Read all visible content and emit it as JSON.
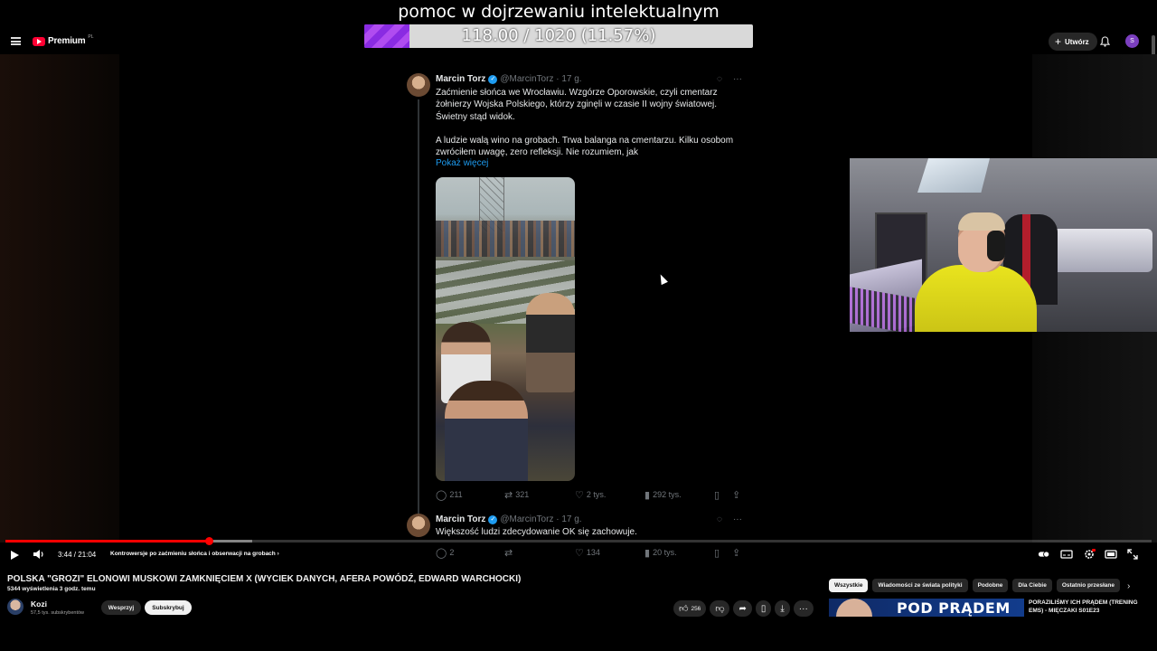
{
  "overlay": {
    "goal_title": "pomoc w dojrzewaniu intelektualnym",
    "goal_progress_text": "118.00 / 1020 (11.57%)",
    "goal_fraction": 0.1157,
    "fill_color": "#8a2be2"
  },
  "header": {
    "logo_text": "Premium",
    "logo_region": "PL",
    "create_label": "Utwórz",
    "avatar_initial": "S",
    "icons": [
      "menu-icon",
      "bell-icon"
    ]
  },
  "tweets": [
    {
      "name": "Marcin Torz",
      "handle": "@MarcinTorz · 17 g.",
      "paragraph1": "Zaćmienie słońca we Wrocławiu. Wzgórze Oporowskie, czyli cmentarz żołnierzy Wojska Polskiego, którzy zginęli w czasie II wojny światowej. Świetny stąd widok.",
      "paragraph2": "A ludzie walą wino na grobach. Trwa balanga na cmentarzu. Kilku osobom zwróciłem uwagę, zero refleksji. Nie rozumiem, jak",
      "show_more": "Pokaż więcej",
      "replies": "211",
      "retweets": "321",
      "likes": "2 tys.",
      "views": "292 tys."
    },
    {
      "name": "Marcin Torz",
      "handle": "@MarcinTorz · 17 g.",
      "text": "Większość ludzi zdecydowanie OK się zachowuje.",
      "replies": "2",
      "retweets": "",
      "likes": "134",
      "views": "20 tys."
    }
  ],
  "player": {
    "time": "3:44 / 21:04",
    "chapter": "Kontrowersje po zaćmieniu słońca i obserwacji na grobach",
    "played_fraction": 0.1776,
    "buffered_fraction": 0.215,
    "progress_color": "#ff0000"
  },
  "video": {
    "title": "POLSKA \"GROZI\" ELONOWI MUSKOWI ZAMKNIĘCIEM X (WYCIEK DANYCH, AFERA POWÓDŹ, EDWARD WARCHOCKI)",
    "meta": "5344 wyświetlenia  3 godz. temu",
    "channel_name": "Kozi",
    "channel_subs": "57,5 tys. subskrybentów",
    "support_label": "Wesprzyj",
    "subscribe_label": "Subskrybuj",
    "likes": "256"
  },
  "sidebar": {
    "chips": [
      "Wszystkie",
      "Wiadomości ze świata polityki",
      "Podobne",
      "Dla Ciebie",
      "Ostatnio przesłane"
    ],
    "rec_thumb_text": "POD PRĄDEM",
    "rec_title": "PORAZILIŚMY ICH PRĄDEM (TRENING EMS) - MIĘCZAKI S01E23"
  }
}
